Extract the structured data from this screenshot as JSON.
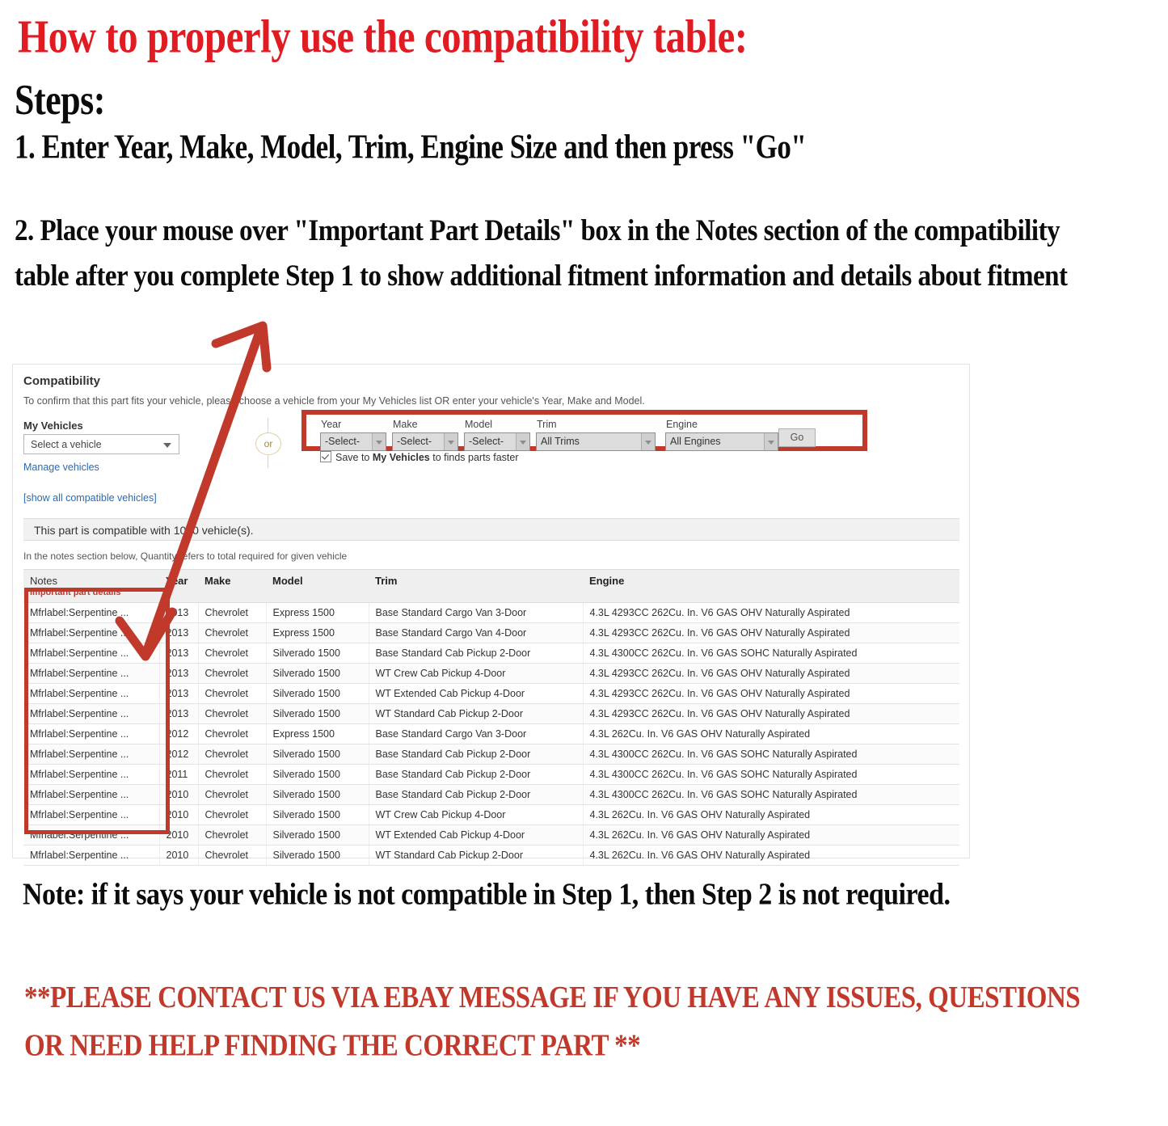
{
  "headings": {
    "title": "How to properly use the compatibility table:",
    "steps_label": "Steps:",
    "step1": "1. Enter Year, Make, Model, Trim, Engine Size and then press \"Go\"",
    "step2": "2. Place your mouse over \"Important Part Details\" box in the Notes section of the compatibility table after you complete Step 1 to show additional fitment information and details about fitment",
    "note": "Note: if it says your vehicle is not compatible in Step 1, then Step 2 is not required.",
    "contact": "**PLEASE CONTACT US VIA EBAY MESSAGE IF YOU HAVE ANY ISSUES, QUESTIONS OR NEED HELP FINDING THE CORRECT PART **"
  },
  "colors": {
    "heading_red": "#e01b22",
    "accent_red": "#c0392b",
    "link_blue": "#2b6ab0"
  },
  "compatibility": {
    "title": "Compatibility",
    "subtitle": "To confirm that this part fits your vehicle, please choose a vehicle from your My Vehicles list OR enter your vehicle's Year, Make and Model.",
    "my_vehicles": {
      "label": "My Vehicles",
      "select_value": "Select a vehicle",
      "manage_link": "Manage vehicles",
      "show_all_link": "[show all compatible vehicles]"
    },
    "or_divider": "or",
    "form": {
      "fields": [
        {
          "label": "Year",
          "value": "-Select-"
        },
        {
          "label": "Make",
          "value": "-Select-"
        },
        {
          "label": "Model",
          "value": "-Select-"
        },
        {
          "label": "Trim",
          "value": "All Trims"
        },
        {
          "label": "Engine",
          "value": "All Engines"
        }
      ],
      "go_button": "Go",
      "save_checkbox": {
        "checked": true,
        "text_before": "Save to ",
        "text_bold": "My Vehicles",
        "text_after": " to finds parts faster"
      }
    },
    "compatible_banner": "This part is compatible with 1000 vehicle(s).",
    "notes_hint": "In the notes section below, Quantity refers to total required for given vehicle",
    "table": {
      "headers": {
        "notes_line1": "Notes",
        "notes_line2": "Important part details",
        "year": "Year",
        "make": "Make",
        "model": "Model",
        "trim": "Trim",
        "engine": "Engine"
      },
      "rows": [
        {
          "notes": "Mfrlabel:Serpentine ...",
          "year": "2013",
          "make": "Chevrolet",
          "model": "Express 1500",
          "trim": "Base Standard Cargo Van 3-Door",
          "engine": "4.3L 4293CC 262Cu. In. V6 GAS OHV Naturally Aspirated"
        },
        {
          "notes": "Mfrlabel:Serpentine ...",
          "year": "2013",
          "make": "Chevrolet",
          "model": "Express 1500",
          "trim": "Base Standard Cargo Van 4-Door",
          "engine": "4.3L 4293CC 262Cu. In. V6 GAS OHV Naturally Aspirated"
        },
        {
          "notes": "Mfrlabel:Serpentine ...",
          "year": "2013",
          "make": "Chevrolet",
          "model": "Silverado 1500",
          "trim": "Base Standard Cab Pickup 2-Door",
          "engine": "4.3L 4300CC 262Cu. In. V6 GAS SOHC Naturally Aspirated"
        },
        {
          "notes": "Mfrlabel:Serpentine ...",
          "year": "2013",
          "make": "Chevrolet",
          "model": "Silverado 1500",
          "trim": "WT Crew Cab Pickup 4-Door",
          "engine": "4.3L 4293CC 262Cu. In. V6 GAS OHV Naturally Aspirated"
        },
        {
          "notes": "Mfrlabel:Serpentine ...",
          "year": "2013",
          "make": "Chevrolet",
          "model": "Silverado 1500",
          "trim": "WT Extended Cab Pickup 4-Door",
          "engine": "4.3L 4293CC 262Cu. In. V6 GAS OHV Naturally Aspirated"
        },
        {
          "notes": "Mfrlabel:Serpentine ...",
          "year": "2013",
          "make": "Chevrolet",
          "model": "Silverado 1500",
          "trim": "WT Standard Cab Pickup 2-Door",
          "engine": "4.3L 4293CC 262Cu. In. V6 GAS OHV Naturally Aspirated"
        },
        {
          "notes": "Mfrlabel:Serpentine ...",
          "year": "2012",
          "make": "Chevrolet",
          "model": "Express 1500",
          "trim": "Base Standard Cargo Van 3-Door",
          "engine": "4.3L 262Cu. In. V6 GAS OHV Naturally Aspirated"
        },
        {
          "notes": "Mfrlabel:Serpentine ...",
          "year": "2012",
          "make": "Chevrolet",
          "model": "Silverado 1500",
          "trim": "Base Standard Cab Pickup 2-Door",
          "engine": "4.3L 4300CC 262Cu. In. V6 GAS SOHC Naturally Aspirated"
        },
        {
          "notes": "Mfrlabel:Serpentine ...",
          "year": "2011",
          "make": "Chevrolet",
          "model": "Silverado 1500",
          "trim": "Base Standard Cab Pickup 2-Door",
          "engine": "4.3L 4300CC 262Cu. In. V6 GAS SOHC Naturally Aspirated"
        },
        {
          "notes": "Mfrlabel:Serpentine ...",
          "year": "2010",
          "make": "Chevrolet",
          "model": "Silverado 1500",
          "trim": "Base Standard Cab Pickup 2-Door",
          "engine": "4.3L 4300CC 262Cu. In. V6 GAS SOHC Naturally Aspirated"
        },
        {
          "notes": "Mfrlabel:Serpentine ...",
          "year": "2010",
          "make": "Chevrolet",
          "model": "Silverado 1500",
          "trim": "WT Crew Cab Pickup 4-Door",
          "engine": "4.3L 262Cu. In. V6 GAS OHV Naturally Aspirated"
        },
        {
          "notes": "Mfrlabel:Serpentine ...",
          "year": "2010",
          "make": "Chevrolet",
          "model": "Silverado 1500",
          "trim": "WT Extended Cab Pickup 4-Door",
          "engine": "4.3L 262Cu. In. V6 GAS OHV Naturally Aspirated"
        },
        {
          "notes": "Mfrlabel:Serpentine ...",
          "year": "2010",
          "make": "Chevrolet",
          "model": "Silverado 1500",
          "trim": "WT Standard Cab Pickup 2-Door",
          "engine": "4.3L 262Cu. In. V6 GAS OHV Naturally Aspirated"
        }
      ]
    }
  }
}
